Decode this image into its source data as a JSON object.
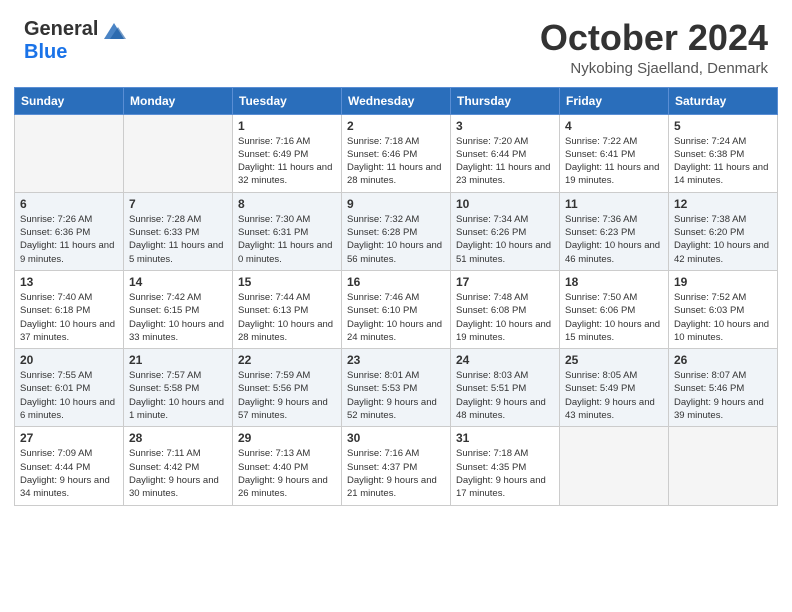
{
  "header": {
    "logo_general": "General",
    "logo_blue": "Blue",
    "month_title": "October 2024",
    "location": "Nykobing Sjaelland, Denmark"
  },
  "days_of_week": [
    "Sunday",
    "Monday",
    "Tuesday",
    "Wednesday",
    "Thursday",
    "Friday",
    "Saturday"
  ],
  "weeks": [
    [
      {
        "day": "",
        "empty": true
      },
      {
        "day": "",
        "empty": true
      },
      {
        "day": "1",
        "sunrise": "7:16 AM",
        "sunset": "6:49 PM",
        "daylight": "11 hours and 32 minutes."
      },
      {
        "day": "2",
        "sunrise": "7:18 AM",
        "sunset": "6:46 PM",
        "daylight": "11 hours and 28 minutes."
      },
      {
        "day": "3",
        "sunrise": "7:20 AM",
        "sunset": "6:44 PM",
        "daylight": "11 hours and 23 minutes."
      },
      {
        "day": "4",
        "sunrise": "7:22 AM",
        "sunset": "6:41 PM",
        "daylight": "11 hours and 19 minutes."
      },
      {
        "day": "5",
        "sunrise": "7:24 AM",
        "sunset": "6:38 PM",
        "daylight": "11 hours and 14 minutes."
      }
    ],
    [
      {
        "day": "6",
        "sunrise": "7:26 AM",
        "sunset": "6:36 PM",
        "daylight": "11 hours and 9 minutes."
      },
      {
        "day": "7",
        "sunrise": "7:28 AM",
        "sunset": "6:33 PM",
        "daylight": "11 hours and 5 minutes."
      },
      {
        "day": "8",
        "sunrise": "7:30 AM",
        "sunset": "6:31 PM",
        "daylight": "11 hours and 0 minutes."
      },
      {
        "day": "9",
        "sunrise": "7:32 AM",
        "sunset": "6:28 PM",
        "daylight": "10 hours and 56 minutes."
      },
      {
        "day": "10",
        "sunrise": "7:34 AM",
        "sunset": "6:26 PM",
        "daylight": "10 hours and 51 minutes."
      },
      {
        "day": "11",
        "sunrise": "7:36 AM",
        "sunset": "6:23 PM",
        "daylight": "10 hours and 46 minutes."
      },
      {
        "day": "12",
        "sunrise": "7:38 AM",
        "sunset": "6:20 PM",
        "daylight": "10 hours and 42 minutes."
      }
    ],
    [
      {
        "day": "13",
        "sunrise": "7:40 AM",
        "sunset": "6:18 PM",
        "daylight": "10 hours and 37 minutes."
      },
      {
        "day": "14",
        "sunrise": "7:42 AM",
        "sunset": "6:15 PM",
        "daylight": "10 hours and 33 minutes."
      },
      {
        "day": "15",
        "sunrise": "7:44 AM",
        "sunset": "6:13 PM",
        "daylight": "10 hours and 28 minutes."
      },
      {
        "day": "16",
        "sunrise": "7:46 AM",
        "sunset": "6:10 PM",
        "daylight": "10 hours and 24 minutes."
      },
      {
        "day": "17",
        "sunrise": "7:48 AM",
        "sunset": "6:08 PM",
        "daylight": "10 hours and 19 minutes."
      },
      {
        "day": "18",
        "sunrise": "7:50 AM",
        "sunset": "6:06 PM",
        "daylight": "10 hours and 15 minutes."
      },
      {
        "day": "19",
        "sunrise": "7:52 AM",
        "sunset": "6:03 PM",
        "daylight": "10 hours and 10 minutes."
      }
    ],
    [
      {
        "day": "20",
        "sunrise": "7:55 AM",
        "sunset": "6:01 PM",
        "daylight": "10 hours and 6 minutes."
      },
      {
        "day": "21",
        "sunrise": "7:57 AM",
        "sunset": "5:58 PM",
        "daylight": "10 hours and 1 minute."
      },
      {
        "day": "22",
        "sunrise": "7:59 AM",
        "sunset": "5:56 PM",
        "daylight": "9 hours and 57 minutes."
      },
      {
        "day": "23",
        "sunrise": "8:01 AM",
        "sunset": "5:53 PM",
        "daylight": "9 hours and 52 minutes."
      },
      {
        "day": "24",
        "sunrise": "8:03 AM",
        "sunset": "5:51 PM",
        "daylight": "9 hours and 48 minutes."
      },
      {
        "day": "25",
        "sunrise": "8:05 AM",
        "sunset": "5:49 PM",
        "daylight": "9 hours and 43 minutes."
      },
      {
        "day": "26",
        "sunrise": "8:07 AM",
        "sunset": "5:46 PM",
        "daylight": "9 hours and 39 minutes."
      }
    ],
    [
      {
        "day": "27",
        "sunrise": "7:09 AM",
        "sunset": "4:44 PM",
        "daylight": "9 hours and 34 minutes."
      },
      {
        "day": "28",
        "sunrise": "7:11 AM",
        "sunset": "4:42 PM",
        "daylight": "9 hours and 30 minutes."
      },
      {
        "day": "29",
        "sunrise": "7:13 AM",
        "sunset": "4:40 PM",
        "daylight": "9 hours and 26 minutes."
      },
      {
        "day": "30",
        "sunrise": "7:16 AM",
        "sunset": "4:37 PM",
        "daylight": "9 hours and 21 minutes."
      },
      {
        "day": "31",
        "sunrise": "7:18 AM",
        "sunset": "4:35 PM",
        "daylight": "9 hours and 17 minutes."
      },
      {
        "day": "",
        "empty": true
      },
      {
        "day": "",
        "empty": true
      }
    ]
  ],
  "labels": {
    "sunrise": "Sunrise:",
    "sunset": "Sunset:",
    "daylight": "Daylight:"
  }
}
